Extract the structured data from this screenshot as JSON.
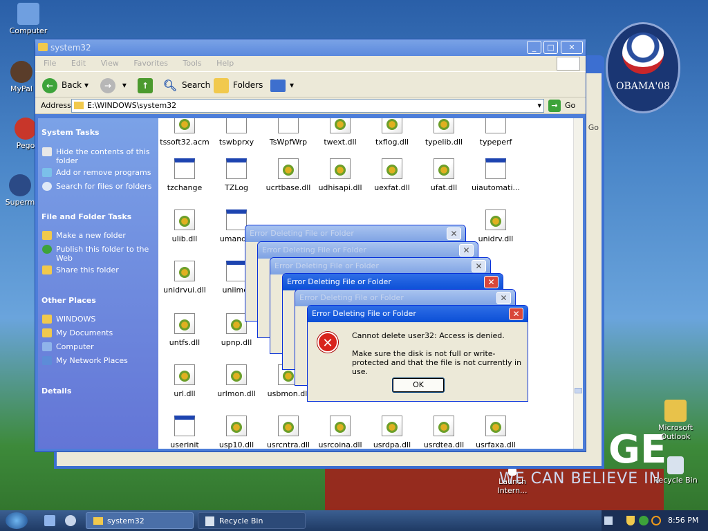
{
  "desktop": {
    "icons": [
      {
        "label": "Computer"
      },
      {
        "label": "MyPal"
      },
      {
        "label": "Pego"
      },
      {
        "label": "Superm"
      },
      {
        "label": "Microsoft Outlook"
      },
      {
        "label": "Launch Intern..."
      },
      {
        "label": "Recycle Bin"
      }
    ],
    "slogan": "WE CAN BELIEVE IN",
    "slogan_big": "GE",
    "badge": "OBAMA'08"
  },
  "back_window": {
    "go_label": "Go"
  },
  "window": {
    "title": "system32",
    "menu": [
      "File",
      "Edit",
      "View",
      "Favorites",
      "Tools",
      "Help"
    ],
    "toolbar": {
      "back": "Back",
      "search": "Search",
      "folders": "Folders"
    },
    "address": {
      "label": "Address",
      "value": "E:\\WINDOWS\\system32",
      "go": "Go"
    },
    "sidebar": {
      "system_tasks": {
        "title": "System Tasks",
        "items": [
          "Hide the contents of this folder",
          "Add or remove programs",
          "Search for files or folders"
        ]
      },
      "file_tasks": {
        "title": "File and Folder Tasks",
        "items": [
          "Make a new folder",
          "Publish this folder to the Web",
          "Share this folder"
        ]
      },
      "other_places": {
        "title": "Other Places",
        "items": [
          "WINDOWS",
          "My Documents",
          "Computer",
          "My Network Places"
        ]
      },
      "details": {
        "title": "Details"
      }
    },
    "files": [
      [
        "tssoft32.acm",
        "tswbprxy",
        "TsWpfWrp",
        "twext.dll",
        "txflog.dll",
        "typelib.dll",
        "typeperf"
      ],
      [
        "tzchange",
        "TZLog",
        "ucrtbase.dll",
        "udhisapi.dll",
        "uexfat.dll",
        "ufat.dll",
        "uiautomati..."
      ],
      [
        "ulib.dll",
        "umandlg",
        "",
        "",
        "",
        "",
        "unidrv.dll"
      ],
      [
        "unidrvui.dll",
        "uniime.",
        "",
        "",
        "",
        "",
        ""
      ],
      [
        "untfs.dll",
        "upnp.dll",
        "",
        "",
        "",
        "",
        ""
      ],
      [
        "url.dll",
        "urlmon.dll",
        "usbmon.dll",
        "",
        "",
        "",
        ""
      ],
      [
        "userinit",
        "usp10.dll",
        "usrcntra.dll",
        "usrcoina.dll",
        "usrdpa.dll",
        "usrdtea.dll",
        "usrfaxa.dll"
      ]
    ]
  },
  "dialogs": {
    "title": "Error Deleting File or Folder",
    "message": "Cannot delete user32: Access is denied.",
    "detail": "Make sure the disk is not full or write-protected and that the file is not currently in use.",
    "ok": "OK"
  },
  "taskbar": {
    "tasks": [
      "system32",
      "Recycle Bin"
    ],
    "clock": "8:56 PM"
  }
}
